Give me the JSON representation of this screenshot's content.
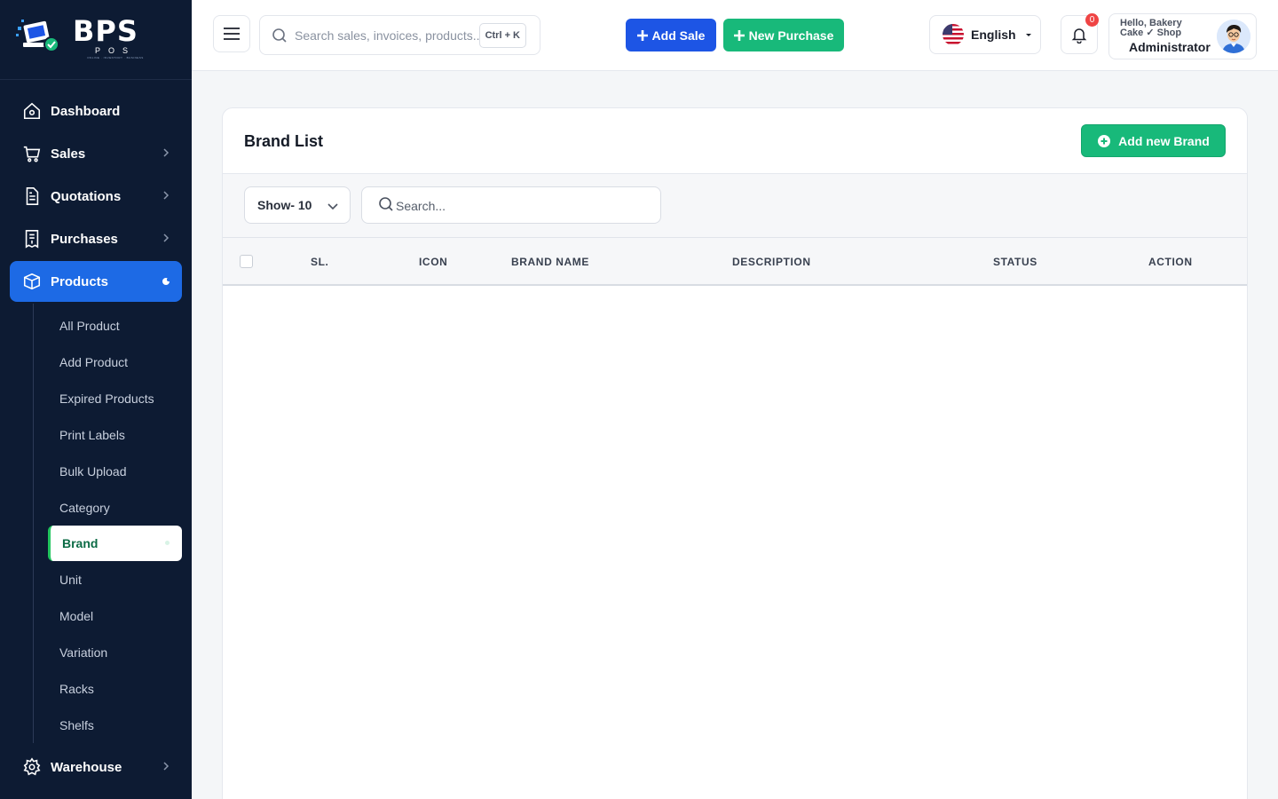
{
  "brand": {
    "logo_text": "BPS",
    "logo_sub": "POS",
    "logo_tag": "ONLINE · INVENTORY · BUSINESS"
  },
  "sidebar": {
    "items": [
      {
        "label": "Dashboard",
        "icon": "home-icon"
      },
      {
        "label": "Sales",
        "icon": "cart-icon"
      },
      {
        "label": "Quotations",
        "icon": "document-icon"
      },
      {
        "label": "Purchases",
        "icon": "receipt-icon"
      },
      {
        "label": "Products",
        "icon": "box-icon"
      },
      {
        "label": "Warehouse",
        "icon": "gear-icon"
      }
    ],
    "product_sub": [
      "All Product",
      "Add Product",
      "Expired Products",
      "Print Labels",
      "Bulk Upload",
      "Category",
      "Brand",
      "Unit",
      "Model",
      "Variation",
      "Racks",
      "Shelfs"
    ]
  },
  "topbar": {
    "search_placeholder": "Search sales, invoices, products...",
    "shortcut": "Ctrl + K",
    "add_sale": "Add Sale",
    "new_purchase": "New Purchase",
    "language": "English",
    "notifications": "0",
    "greeting": "Hello, Bakery Cake ✓ Shop",
    "role": "Administrator"
  },
  "page": {
    "title": "Brand List",
    "add_button": "Add new Brand",
    "show_label": "Show- 10",
    "search_placeholder": "Search..."
  },
  "table": {
    "columns": [
      "SL.",
      "ICON",
      "BRAND NAME",
      "DESCRIPTION",
      "STATUS",
      "ACTION"
    ],
    "rows": []
  },
  "colors": {
    "sidebar_bg": "#0d1b33",
    "primary_blue": "#1d55e5",
    "primary_green": "#18b97a",
    "active_nav": "#1d6ae5"
  }
}
